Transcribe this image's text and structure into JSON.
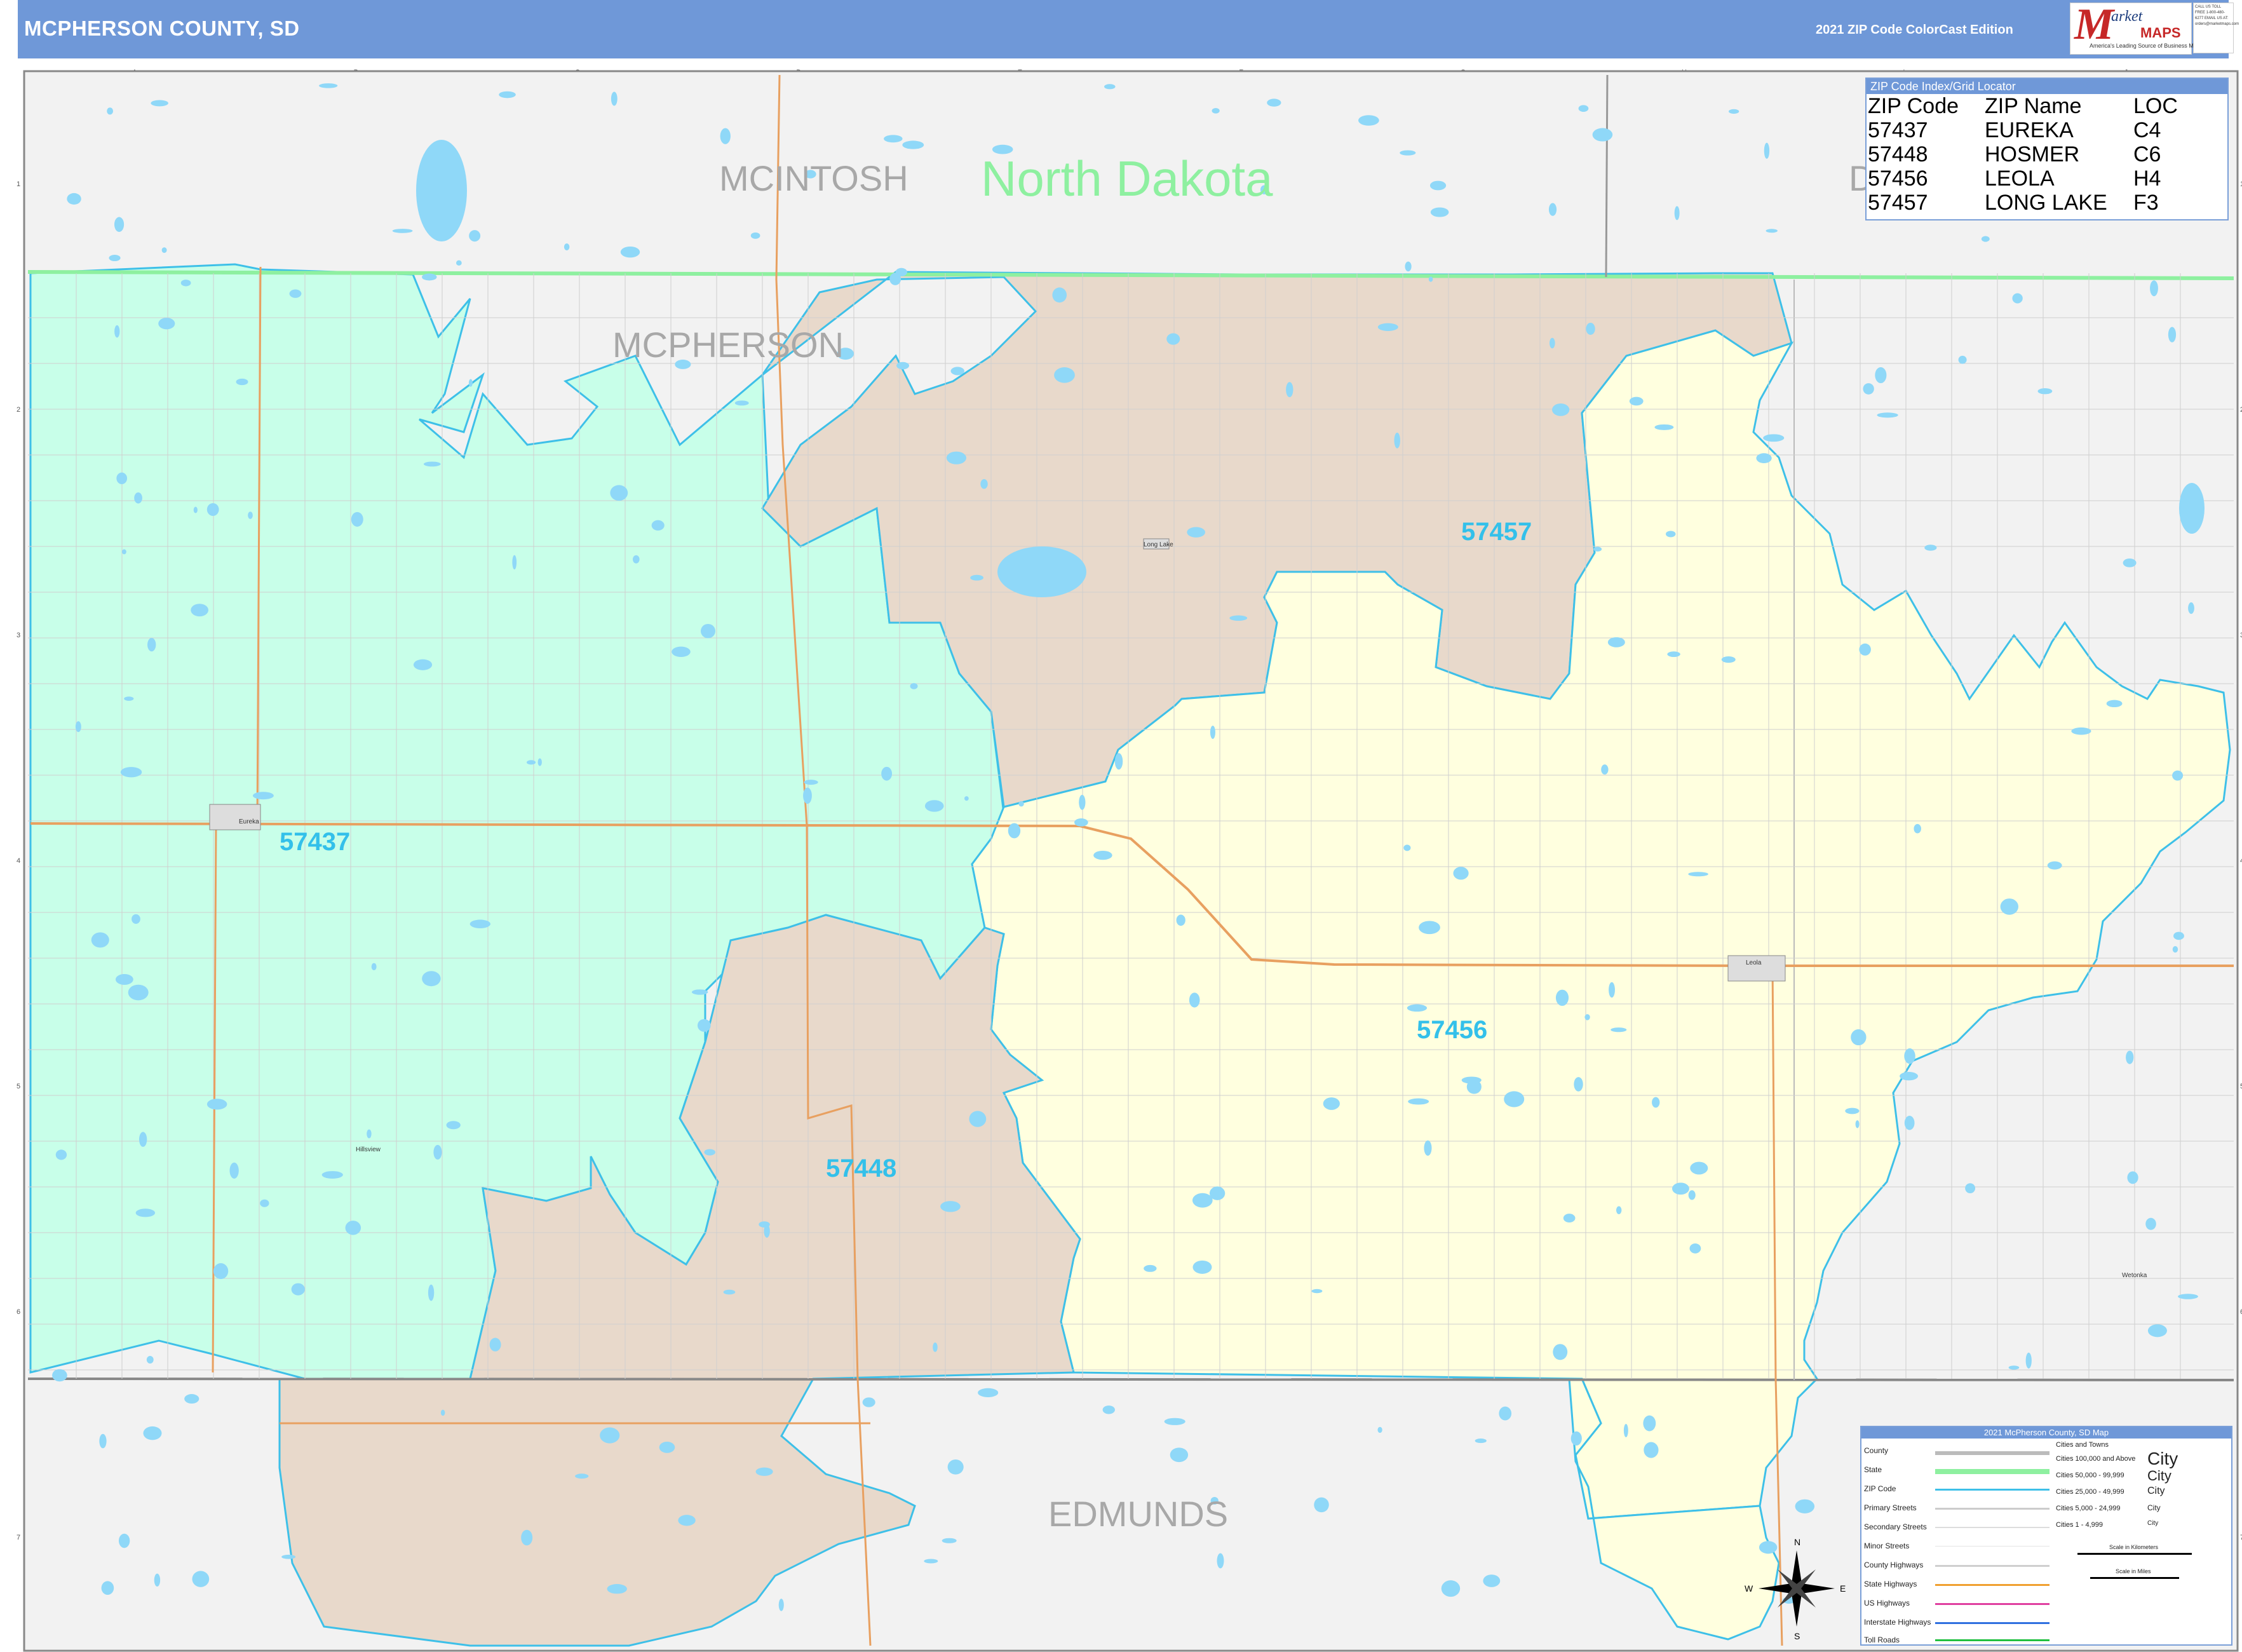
{
  "header": {
    "title": "MCPHERSON COUNTY, SD",
    "edition": "2021 ZIP Code ColorCast Edition",
    "logo_market": "arket",
    "logo_maps": "MAPS",
    "logo_tagline": "America's Leading Source of Business Maps",
    "contact": "CALL US TOLL FREE 1-800-480-6277 EMAIL US AT: orders@marketmaps.com"
  },
  "grid": {
    "columns": [
      "A",
      "B",
      "C",
      "D",
      "E",
      "F",
      "G",
      "H",
      "I",
      "J"
    ],
    "rows": [
      "1",
      "2",
      "3",
      "4",
      "5",
      "6",
      "7"
    ]
  },
  "map": {
    "labels": {
      "mcintosh": "MCINTOSH",
      "north_dakota": "North Dakota",
      "mcpherson": "MCPHERSON",
      "edmunds": "EDMUNDS",
      "dickey_partial": "D"
    },
    "zip_labels": [
      "57457",
      "57437",
      "57456",
      "57448"
    ],
    "towns": [
      "Eureka",
      "Long Lake",
      "Leola",
      "Hillsview",
      "Wetonka"
    ],
    "colors": {
      "57437": "#c8ffe9",
      "57448": "#e8d9cb",
      "57456": "#ffffdf",
      "57457": "#e8d9cb",
      "outside": "#f2f2f2",
      "zip_border": "#3ec0e8",
      "state_line": "#8ef0a0",
      "roads": "#e8a060",
      "water": "#8fd8f8"
    }
  },
  "zip_index": {
    "title": "ZIP Code Index/Grid Locator",
    "headers": [
      "ZIP Code",
      "ZIP Name",
      "LOC"
    ],
    "rows": [
      [
        "57437",
        "EUREKA",
        "C4"
      ],
      [
        "57448",
        "HOSMER",
        "C6"
      ],
      [
        "57456",
        "LEOLA",
        "H4"
      ],
      [
        "57457",
        "LONG LAKE",
        "F3"
      ]
    ]
  },
  "legend": {
    "title": "2021 McPherson County, SD Map",
    "items": [
      "County",
      "State",
      "ZIP Code",
      "Primary Streets",
      "Secondary Streets",
      "Minor Streets",
      "County Highways",
      "State Highways",
      "US Highways",
      "Interstate Highways",
      "Toll Roads"
    ],
    "cities_title": "Cities and Towns",
    "cities": [
      "Cities 100,000 and Above",
      "Cities 50,000 - 99,999",
      "Cities 25,000 - 49,999",
      "Cities 5,000 - 24,999",
      "Cities 1 - 4,999"
    ],
    "city_samples": [
      "City",
      "City",
      "City",
      "City",
      "City"
    ],
    "scale_km": "Scale in Kilometers",
    "scale_mi": "Scale in Miles",
    "compass": [
      "N",
      "S",
      "E",
      "W"
    ]
  }
}
